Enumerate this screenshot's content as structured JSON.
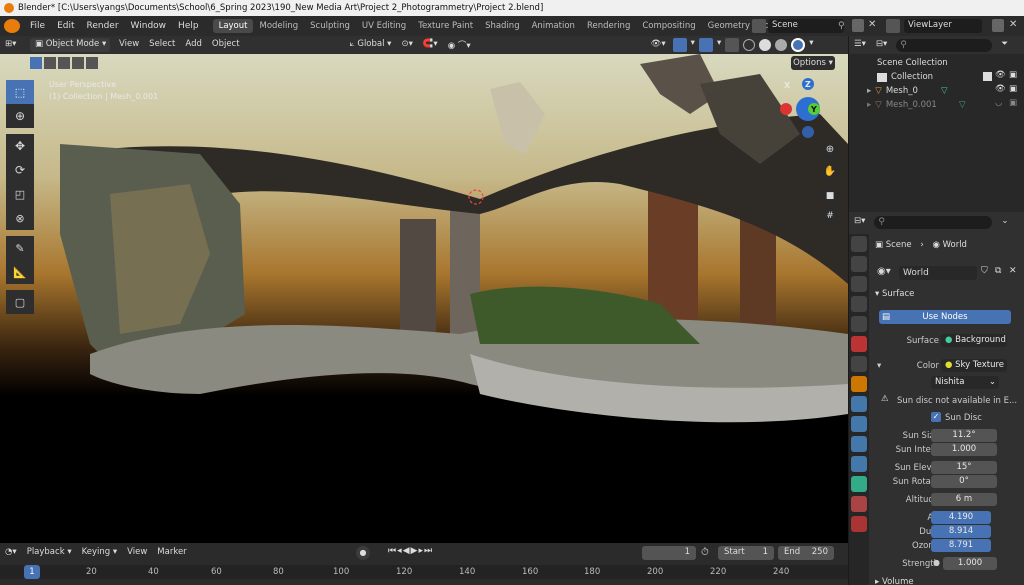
{
  "window": {
    "title": "Blender* [C:\\Users\\yangs\\Documents\\School\\6_Spring 2023\\190_New Media Art\\Project 2_Photogrammetry\\Project 2.blend]"
  },
  "menu": [
    "File",
    "Edit",
    "Render",
    "Window",
    "Help"
  ],
  "workspaces": [
    "Layout",
    "Modeling",
    "Sculpting",
    "UV Editing",
    "Texture Paint",
    "Shading",
    "Animation",
    "Rendering",
    "Compositing",
    "Geometry Nodes"
  ],
  "scene_name": "Scene",
  "view_layer": "ViewLayer",
  "viewport_header": {
    "mode": "Object Mode",
    "menus": [
      "View",
      "Select",
      "Add",
      "Object"
    ],
    "transform_orientation": "Global"
  },
  "viewport": {
    "perspective": "User Perspective",
    "collection_info": "(1) Collection | Mesh_0.001",
    "options_label": "Options",
    "gizmo_axes": [
      "X",
      "Y",
      "Z"
    ]
  },
  "outliner": {
    "root": "Scene Collection",
    "items": [
      {
        "label": "Collection"
      },
      {
        "label": "Mesh_0"
      },
      {
        "label": "Mesh_0.001"
      }
    ]
  },
  "properties": {
    "breadcrumb": [
      "Scene",
      "World"
    ],
    "world_name": "World",
    "section_surface": "Surface",
    "use_nodes": "Use Nodes",
    "surface_label": "Surface",
    "surface_value": "Background",
    "color_label": "Color",
    "color_value": "Sky Texture",
    "sky_type": "Nishita",
    "warning": "Sun disc not available in E...",
    "sun_disc": "Sun Disc",
    "fields": [
      {
        "label": "Sun Size",
        "value": "11.2°",
        "style": "normal"
      },
      {
        "label": "Sun Inte...",
        "value": "1.000",
        "style": "normal"
      },
      {
        "label": "Sun Elev...",
        "value": "15°",
        "style": "normal"
      },
      {
        "label": "Sun Rota...",
        "value": "0°",
        "style": "normal"
      },
      {
        "label": "Altitude",
        "value": "6 m",
        "style": "normal"
      },
      {
        "label": "Air",
        "value": "4.190",
        "style": "blue"
      },
      {
        "label": "Dust",
        "value": "8.914",
        "style": "blue"
      },
      {
        "label": "Ozone",
        "value": "8.791",
        "style": "blue"
      },
      {
        "label": "Strength",
        "value": "1.000",
        "style": "normal"
      }
    ],
    "volume_label": "Volume"
  },
  "timeline": {
    "menus": [
      "Playback",
      "Keying",
      "View",
      "Marker"
    ],
    "current_frame": "1",
    "start_label": "Start",
    "start_value": "1",
    "end_label": "End",
    "end_value": "250",
    "ruler_current": "1",
    "ruler_ticks": [
      "20",
      "40",
      "60",
      "80",
      "100",
      "120",
      "140",
      "160",
      "180",
      "200",
      "220",
      "240"
    ]
  },
  "colors": {
    "accent": "#4772b3",
    "selection": "#334d80",
    "blender_orange": "#e87d0d"
  }
}
